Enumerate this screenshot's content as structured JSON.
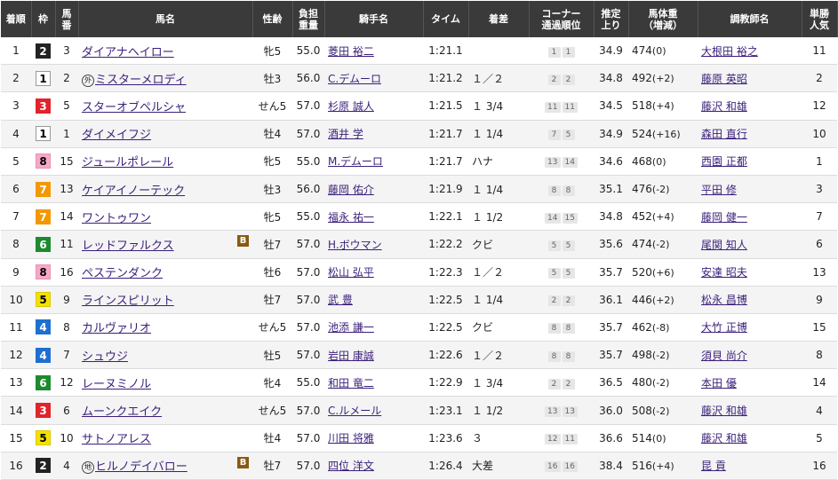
{
  "headers": {
    "rank": "着順",
    "waku": "枠",
    "num": [
      "馬",
      "番"
    ],
    "horse": "馬名",
    "sex_age": "性齢",
    "weight": [
      "負担",
      "重量"
    ],
    "jockey": "騎手名",
    "time": "タイム",
    "margin": "着差",
    "corner": [
      "コーナー",
      "通過順位"
    ],
    "last3f": [
      "推定",
      "上り"
    ],
    "body_weight": [
      "馬体重",
      "（増減）"
    ],
    "trainer": "調教師名",
    "popularity": [
      "単勝",
      "人気"
    ]
  },
  "blinker_label": "B",
  "rows": [
    {
      "rank": "1",
      "waku": "2",
      "num": "3",
      "marker": "",
      "horse": "ダイアナヘイロー",
      "blinker": false,
      "sex_age": "牝5",
      "weight": "55.0",
      "jockey": "菱田 裕二",
      "time": "1:21.1",
      "margin": "",
      "c1": "1",
      "c2": "1",
      "last3f": "34.9",
      "bw": "474",
      "bwc": "(0)",
      "trainer": "大根田 裕之",
      "pop": "11"
    },
    {
      "rank": "2",
      "waku": "1",
      "num": "2",
      "marker": "外",
      "horse": "ミスターメロディ",
      "blinker": false,
      "sex_age": "牡3",
      "weight": "56.0",
      "jockey": "C.デムーロ",
      "time": "1:21.2",
      "margin": "１／２",
      "c1": "2",
      "c2": "2",
      "last3f": "34.8",
      "bw": "492",
      "bwc": "(+2)",
      "trainer": "藤原 英昭",
      "pop": "2"
    },
    {
      "rank": "3",
      "waku": "3",
      "num": "5",
      "marker": "",
      "horse": "スターオブペルシャ",
      "blinker": false,
      "sex_age": "せん5",
      "weight": "57.0",
      "jockey": "杉原 誠人",
      "time": "1:21.5",
      "margin": "１ 3/4",
      "c1": "11",
      "c2": "11",
      "last3f": "34.5",
      "bw": "518",
      "bwc": "(+4)",
      "trainer": "藤沢 和雄",
      "pop": "12"
    },
    {
      "rank": "4",
      "waku": "1",
      "num": "1",
      "marker": "",
      "horse": "ダイメイフジ",
      "blinker": false,
      "sex_age": "牡4",
      "weight": "57.0",
      "jockey": "酒井 学",
      "time": "1:21.7",
      "margin": "１ 1/4",
      "c1": "7",
      "c2": "5",
      "last3f": "34.9",
      "bw": "524",
      "bwc": "(+16)",
      "trainer": "森田 直行",
      "pop": "10"
    },
    {
      "rank": "5",
      "waku": "8",
      "num": "15",
      "marker": "",
      "horse": "ジュールポレール",
      "blinker": false,
      "sex_age": "牝5",
      "weight": "55.0",
      "jockey": "M.デムーロ",
      "time": "1:21.7",
      "margin": "ハナ",
      "c1": "13",
      "c2": "14",
      "last3f": "34.6",
      "bw": "468",
      "bwc": "(0)",
      "trainer": "西園 正都",
      "pop": "1"
    },
    {
      "rank": "6",
      "waku": "7",
      "num": "13",
      "marker": "",
      "horse": "ケイアイノーテック",
      "blinker": false,
      "sex_age": "牡3",
      "weight": "56.0",
      "jockey": "藤岡 佑介",
      "time": "1:21.9",
      "margin": "１ 1/4",
      "c1": "8",
      "c2": "8",
      "last3f": "35.1",
      "bw": "476",
      "bwc": "(-2)",
      "trainer": "平田 修",
      "pop": "3"
    },
    {
      "rank": "7",
      "waku": "7",
      "num": "14",
      "marker": "",
      "horse": "ワントゥワン",
      "blinker": false,
      "sex_age": "牝5",
      "weight": "55.0",
      "jockey": "福永 祐一",
      "time": "1:22.1",
      "margin": "１ 1/2",
      "c1": "14",
      "c2": "15",
      "last3f": "34.8",
      "bw": "452",
      "bwc": "(+4)",
      "trainer": "藤岡 健一",
      "pop": "7"
    },
    {
      "rank": "8",
      "waku": "6",
      "num": "11",
      "marker": "",
      "horse": "レッドファルクス",
      "blinker": true,
      "sex_age": "牡7",
      "weight": "57.0",
      "jockey": "H.ボウマン",
      "time": "1:22.2",
      "margin": "クビ",
      "c1": "5",
      "c2": "5",
      "last3f": "35.6",
      "bw": "474",
      "bwc": "(-2)",
      "trainer": "尾関 知人",
      "pop": "6"
    },
    {
      "rank": "9",
      "waku": "8",
      "num": "16",
      "marker": "",
      "horse": "ペステンダンク",
      "blinker": false,
      "sex_age": "牡6",
      "weight": "57.0",
      "jockey": "松山 弘平",
      "time": "1:22.3",
      "margin": "１／２",
      "c1": "5",
      "c2": "5",
      "last3f": "35.7",
      "bw": "520",
      "bwc": "(+6)",
      "trainer": "安達 昭夫",
      "pop": "13"
    },
    {
      "rank": "10",
      "waku": "5",
      "num": "9",
      "marker": "",
      "horse": "ラインスピリット",
      "blinker": false,
      "sex_age": "牡7",
      "weight": "57.0",
      "jockey": "武 豊",
      "time": "1:22.5",
      "margin": "１ 1/4",
      "c1": "2",
      "c2": "2",
      "last3f": "36.1",
      "bw": "446",
      "bwc": "(+2)",
      "trainer": "松永 昌博",
      "pop": "9"
    },
    {
      "rank": "11",
      "waku": "4",
      "num": "8",
      "marker": "",
      "horse": "カルヴァリオ",
      "blinker": false,
      "sex_age": "せん5",
      "weight": "57.0",
      "jockey": "池添 謙一",
      "time": "1:22.5",
      "margin": "クビ",
      "c1": "8",
      "c2": "8",
      "last3f": "35.7",
      "bw": "462",
      "bwc": "(-8)",
      "trainer": "大竹 正博",
      "pop": "15"
    },
    {
      "rank": "12",
      "waku": "4",
      "num": "7",
      "marker": "",
      "horse": "シュウジ",
      "blinker": false,
      "sex_age": "牡5",
      "weight": "57.0",
      "jockey": "岩田 康誠",
      "time": "1:22.6",
      "margin": "１／２",
      "c1": "8",
      "c2": "8",
      "last3f": "35.7",
      "bw": "498",
      "bwc": "(-2)",
      "trainer": "須貝 尚介",
      "pop": "8"
    },
    {
      "rank": "13",
      "waku": "6",
      "num": "12",
      "marker": "",
      "horse": "レーヌミノル",
      "blinker": false,
      "sex_age": "牝4",
      "weight": "55.0",
      "jockey": "和田 竜二",
      "time": "1:22.9",
      "margin": "１ 3/4",
      "c1": "2",
      "c2": "2",
      "last3f": "36.5",
      "bw": "480",
      "bwc": "(-2)",
      "trainer": "本田 優",
      "pop": "14"
    },
    {
      "rank": "14",
      "waku": "3",
      "num": "6",
      "marker": "",
      "horse": "ムーンクエイク",
      "blinker": false,
      "sex_age": "せん5",
      "weight": "57.0",
      "jockey": "C.ルメール",
      "time": "1:23.1",
      "margin": "１ 1/2",
      "c1": "13",
      "c2": "13",
      "last3f": "36.0",
      "bw": "508",
      "bwc": "(-2)",
      "trainer": "藤沢 和雄",
      "pop": "4"
    },
    {
      "rank": "15",
      "waku": "5",
      "num": "10",
      "marker": "",
      "horse": "サトノアレス",
      "blinker": false,
      "sex_age": "牡4",
      "weight": "57.0",
      "jockey": "川田 将雅",
      "time": "1:23.6",
      "margin": "３",
      "c1": "12",
      "c2": "11",
      "last3f": "36.6",
      "bw": "514",
      "bwc": "(0)",
      "trainer": "藤沢 和雄",
      "pop": "5"
    },
    {
      "rank": "16",
      "waku": "2",
      "num": "4",
      "marker": "地",
      "horse": "ヒルノデイバロー",
      "blinker": true,
      "sex_age": "牡7",
      "weight": "57.0",
      "jockey": "四位 洋文",
      "time": "1:26.4",
      "margin": "大差",
      "c1": "16",
      "c2": "16",
      "last3f": "38.4",
      "bw": "516",
      "bwc": "(+4)",
      "trainer": "昆 貢",
      "pop": "16"
    }
  ]
}
